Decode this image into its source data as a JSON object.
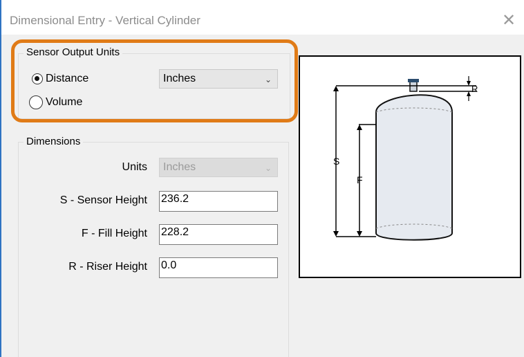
{
  "window": {
    "title": "Dimensional Entry - Vertical Cylinder"
  },
  "sensor_output": {
    "group_label": "Sensor Output Units",
    "options": [
      {
        "label": "Distance",
        "checked": true
      },
      {
        "label": "Volume",
        "checked": false
      }
    ],
    "units_selected": "Inches"
  },
  "dimensions": {
    "group_label": "Dimensions",
    "units_label": "Units",
    "units_selected": "Inches",
    "fields": [
      {
        "label": "S - Sensor Height",
        "value": "236.2"
      },
      {
        "label": "F - Fill Height",
        "value": "228.2"
      },
      {
        "label": "R - Riser Height",
        "value": "0.0"
      }
    ]
  },
  "diagram": {
    "labels": {
      "s": "S",
      "f": "F",
      "r": "R"
    }
  },
  "colors": {
    "highlight": "#e07b17",
    "window_border": "#2f73c2"
  }
}
